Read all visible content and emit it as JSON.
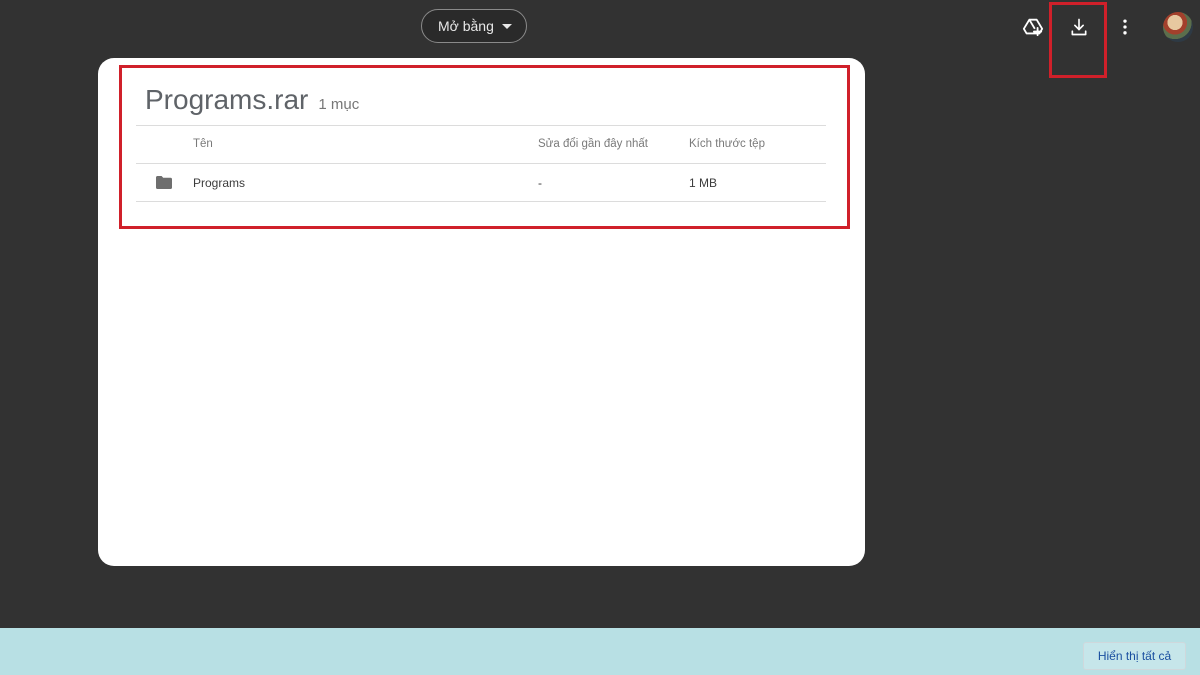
{
  "toolbar": {
    "open_with_label": "Mở bằng",
    "icons": [
      "add-to-drive-icon",
      "download-icon",
      "more-vert-icon",
      "avatar"
    ]
  },
  "file": {
    "name": "Programs.rar",
    "item_count": "1 mục"
  },
  "table": {
    "columns": [
      "Tên",
      "Sửa đổi gần đây nhất",
      "Kích thước tệp"
    ],
    "rows": [
      {
        "icon": "folder-icon",
        "name": "Programs",
        "modified": "-",
        "size": "1 MB"
      }
    ]
  },
  "bottom_bar": {
    "show_all_label": "Hiển thị tất cả"
  },
  "colors": {
    "background": "#323232",
    "card": "#ffffff",
    "highlight": "#d0202a",
    "bottom_bar": "#b8e0e4",
    "link": "#1a4fa0"
  }
}
